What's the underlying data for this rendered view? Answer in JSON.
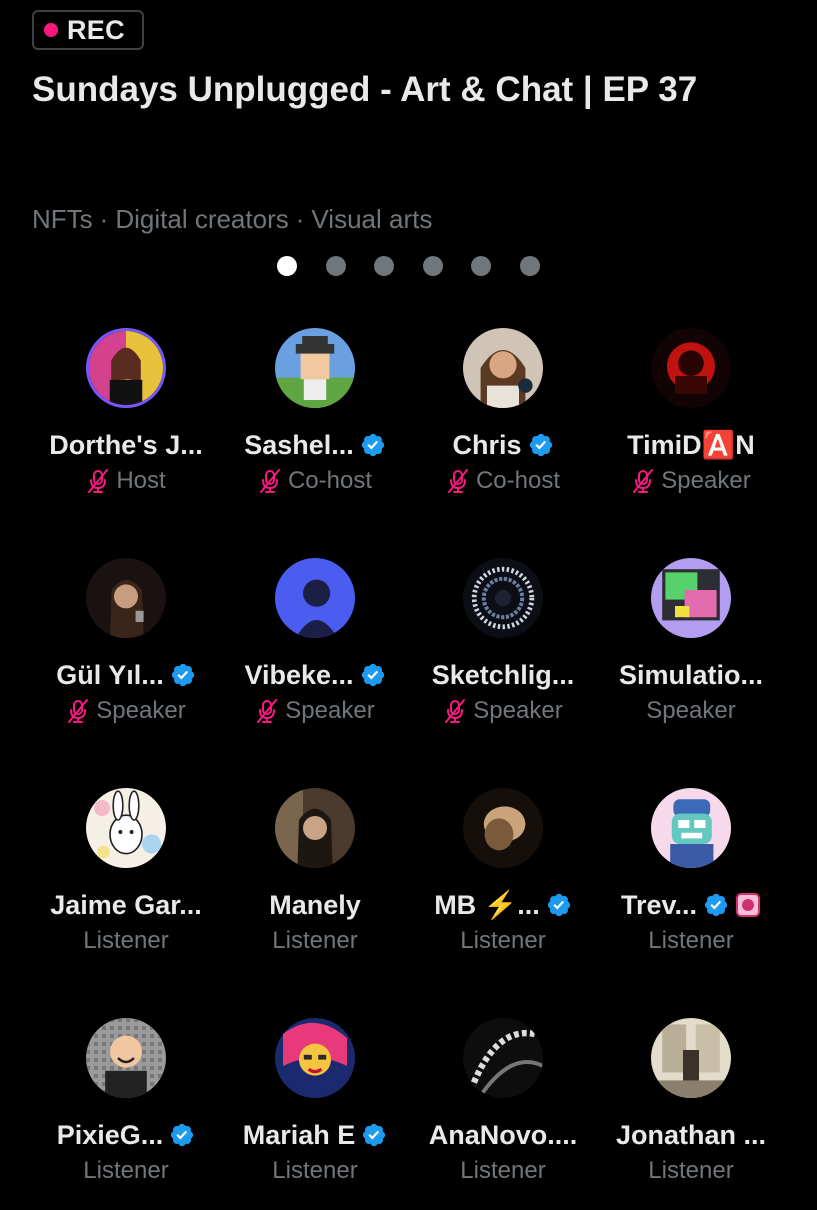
{
  "status": {
    "rec_label": "REC"
  },
  "space": {
    "title": "Sundays Unplugged - Art & Chat | EP 37",
    "topics": [
      "NFTs",
      "Digital creators",
      "Visual arts"
    ],
    "page_count": 6,
    "active_page": 1
  },
  "colors": {
    "background": "#000000",
    "text": "#e7e9ea",
    "muted": "#71767b",
    "rec_dot": "#f91880",
    "muted_mic": "#f91880",
    "verified": "#1d9bf0",
    "host_ring": "#7856ff"
  },
  "participants": [
    {
      "name": "Dorthe's J...",
      "role": "Host",
      "verified": false,
      "muted": true,
      "avatar": "host-portrait"
    },
    {
      "name": "Sashel...",
      "role": "Co-host",
      "verified": true,
      "muted": true,
      "avatar": "pixel-character"
    },
    {
      "name": "Chris",
      "role": "Co-host",
      "verified": true,
      "muted": true,
      "avatar": "portrait"
    },
    {
      "name": "TimiD🅰️N",
      "role": "Speaker",
      "verified": false,
      "muted": true,
      "avatar": "red-glow-art"
    },
    {
      "name": "Gül Yıl...",
      "role": "Speaker",
      "verified": true,
      "muted": true,
      "avatar": "portrait-dark"
    },
    {
      "name": "Vibeke...",
      "role": "Speaker",
      "verified": true,
      "muted": true,
      "avatar": "blue-profile-art"
    },
    {
      "name": "Sketchlig...",
      "role": "Speaker",
      "verified": false,
      "muted": true,
      "avatar": "swirl-art"
    },
    {
      "name": "Simulatio...",
      "role": "Speaker",
      "verified": false,
      "muted": false,
      "avatar": "collage-art"
    },
    {
      "name": "Jaime Gar...",
      "role": "Listener",
      "verified": false,
      "muted": false,
      "avatar": "bunny-illustration"
    },
    {
      "name": "Manely",
      "role": "Listener",
      "verified": false,
      "muted": false,
      "avatar": "portrait-sepia"
    },
    {
      "name": "MB ⚡️...",
      "role": "Listener",
      "verified": true,
      "muted": false,
      "avatar": "blurred-photo"
    },
    {
      "name": "Trev...",
      "role": "Listener",
      "verified": true,
      "muted": false,
      "sticker": true,
      "avatar": "cartoon-beanie"
    },
    {
      "name": "PixieG...",
      "role": "Listener",
      "verified": true,
      "muted": false,
      "avatar": "cartoon-man"
    },
    {
      "name": "Mariah E",
      "role": "Listener",
      "verified": true,
      "muted": false,
      "avatar": "pop-art-face"
    },
    {
      "name": "AnaNovo....",
      "role": "Listener",
      "verified": false,
      "muted": false,
      "avatar": "bw-art"
    },
    {
      "name": "Jonathan ...",
      "role": "Listener",
      "verified": false,
      "muted": false,
      "avatar": "gallery-photo"
    }
  ]
}
